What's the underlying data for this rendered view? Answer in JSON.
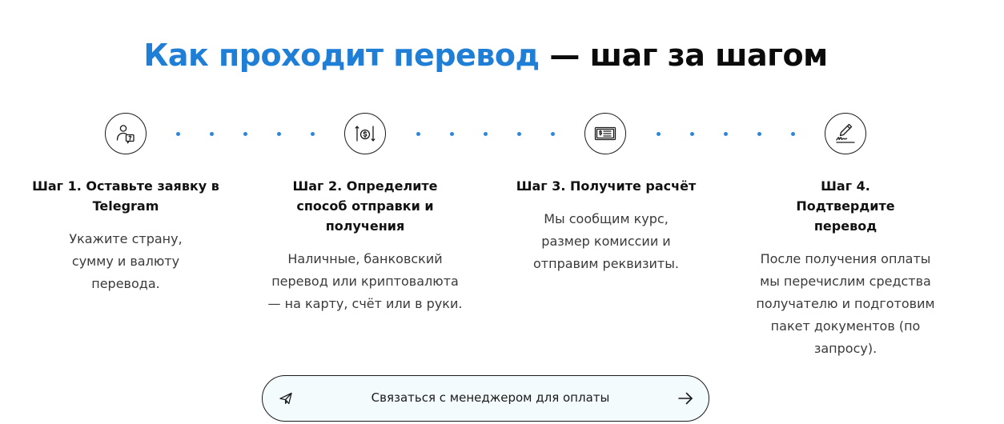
{
  "heading": {
    "accent": "Как проходит перевод",
    "rest": " — шаг за шагом"
  },
  "steps": [
    {
      "icon": "user-question-icon",
      "title": "Шаг 1. Оставьте заявку в Telegram",
      "text": "Укажите страну, сумму и валюту перевода."
    },
    {
      "icon": "currency-exchange-icon",
      "title": "Шаг 2. Определите способ отправки и получения",
      "text": "Наличные, банковский перевод или криптовалюта — на карту, счёт или в руки."
    },
    {
      "icon": "invoice-icon",
      "title": "Шаг 3. Получите расчёт",
      "text": "Мы сообщим курс, размер комиссии и отправим реквизиты."
    },
    {
      "icon": "signature-icon",
      "title": "Шаг 4. Подтвердите перевод",
      "text": "После получения оплаты мы перечислим средства получателю и подготовим пакет документов (по запросу)."
    }
  ],
  "cta": {
    "label": "Связаться с менеджером для оплаты",
    "left_icon": "send-icon",
    "right_icon": "arrow-right-icon"
  },
  "colors": {
    "accent": "#1f7fd6",
    "dots": "#2f86d8",
    "cta_background": "#f4fbfd"
  }
}
